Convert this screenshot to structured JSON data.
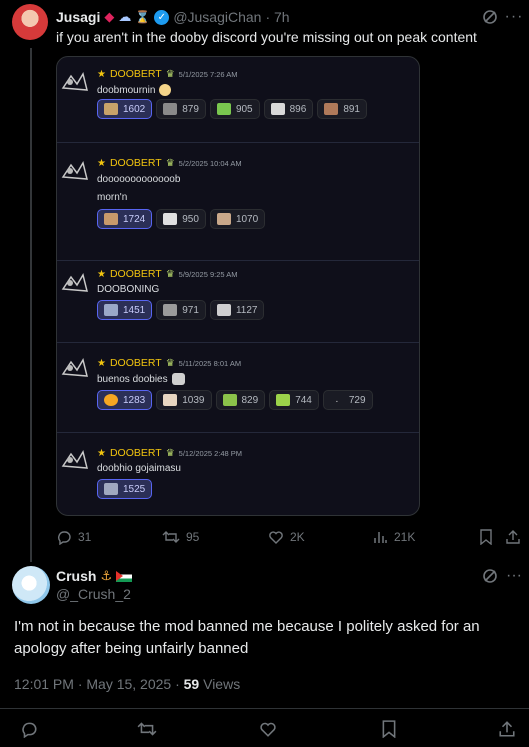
{
  "post1": {
    "name": "Jusagi",
    "handle": "@JusagiChan",
    "time": "· 7h",
    "text": "if you aren't in the dooby discord you're missing out on peak content",
    "actions": {
      "replies": "31",
      "reposts": "95",
      "likes": "2K",
      "views": "21K"
    }
  },
  "embed": {
    "messages": [
      {
        "name": "DOOBERT",
        "time": "5/1/2025 7:26 AM",
        "lines": [
          "doobmournin"
        ],
        "reactions": [
          {
            "count": "1602",
            "me": true,
            "color": "#c8a36a"
          },
          {
            "count": "879",
            "me": false,
            "color": "#8a8a8a"
          },
          {
            "count": "905",
            "me": false,
            "color": "#7ac74f"
          },
          {
            "count": "896",
            "me": false,
            "color": "#d9d9d9"
          },
          {
            "count": "891",
            "me": false,
            "color": "#b07a5a"
          }
        ]
      },
      {
        "name": "DOOBERT",
        "time": "5/2/2025 10:04 AM",
        "lines": [
          "dooooooooooooob",
          "morn'n"
        ],
        "reactions": [
          {
            "count": "1724",
            "me": true,
            "color": "#c99a6b"
          },
          {
            "count": "950",
            "me": false,
            "color": "#e0e0e0"
          },
          {
            "count": "1070",
            "me": false,
            "color": "#c9a88a"
          }
        ]
      },
      {
        "name": "DOOBERT",
        "time": "5/9/2025 9:25 AM",
        "lines": [
          "DOOBONING"
        ],
        "reactions": [
          {
            "count": "1451",
            "me": true,
            "color": "#9aa8c8"
          },
          {
            "count": "971",
            "me": false,
            "color": "#9a9a9a"
          },
          {
            "count": "1127",
            "me": false,
            "color": "#d0d0d0"
          }
        ]
      },
      {
        "name": "DOOBERT",
        "time": "5/11/2025 8:01 AM",
        "lines": [
          "buenos doobies"
        ],
        "reactions": [
          {
            "count": "1283",
            "me": true,
            "color": "#f5a623"
          },
          {
            "count": "1039",
            "me": false,
            "color": "#e8d6c0"
          },
          {
            "count": "829",
            "me": false,
            "color": "#8bc34a"
          },
          {
            "count": "744",
            "me": false,
            "color": "#9bd34a"
          },
          {
            "count": "729",
            "me": false,
            "color": "#d0d0d0"
          }
        ]
      },
      {
        "name": "DOOBERT",
        "time": "5/12/2025 2:48 PM",
        "lines": [
          "doobhio gojaimasu"
        ],
        "reactions": [
          {
            "count": "1525",
            "me": true,
            "color": "#a0a8c0"
          }
        ]
      }
    ]
  },
  "post2": {
    "name": "Crush",
    "handle": "@_Crush_2",
    "text": "I'm not in because the mod banned me because I politely asked for an apology after being unfairly banned",
    "timestamp": "12:01 PM · May 15, 2025 · ",
    "views_count": "59",
    "views_label": " Views"
  },
  "colors": {
    "accent": "#1d9bf0",
    "discord_blurple": "#5865f2",
    "doobert_gold": "#f1c40f"
  }
}
